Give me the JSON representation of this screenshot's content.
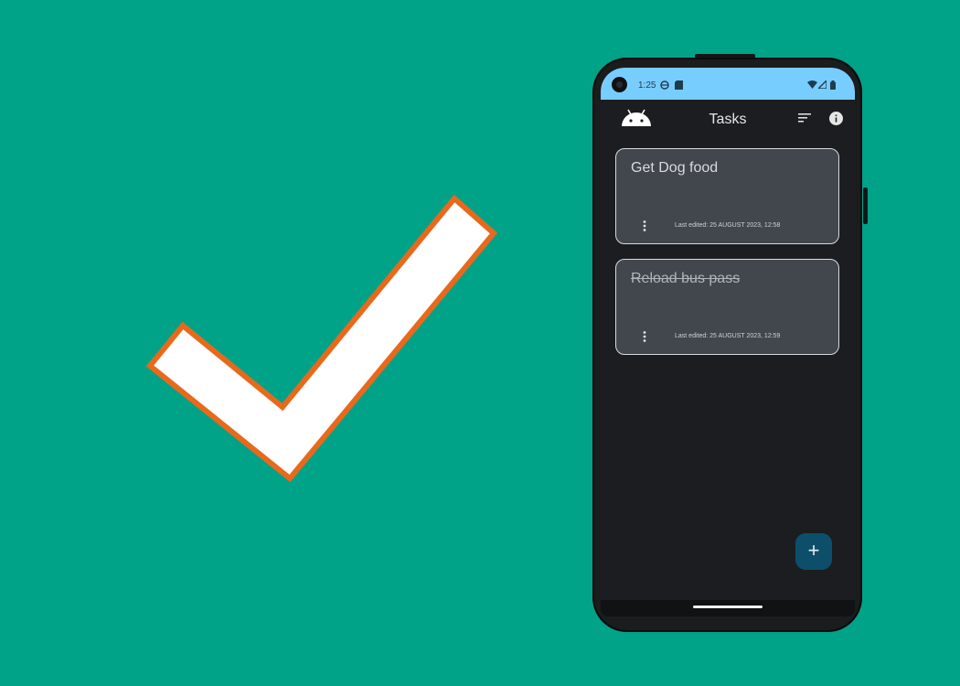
{
  "background_color": "#00a387",
  "accent_color": "#e8691c",
  "status_bar": {
    "time": "1:25",
    "icons": [
      "vpn-globe-icon",
      "sd-card-icon",
      "wifi-icon",
      "signal-icon",
      "battery-icon"
    ]
  },
  "app_bar": {
    "title": "Tasks",
    "logo_icon": "android-logo-icon",
    "actions": [
      "sort-icon",
      "info-icon"
    ]
  },
  "tasks": [
    {
      "title": "Get Dog food",
      "completed": false,
      "last_edited": "Last edited: 25 AUGUST 2023, 12:58"
    },
    {
      "title": "Reload bus pass",
      "completed": true,
      "last_edited": "Last edited: 25 AUGUST 2023, 12:59"
    }
  ],
  "fab": {
    "label": "+",
    "icon": "add-icon"
  }
}
